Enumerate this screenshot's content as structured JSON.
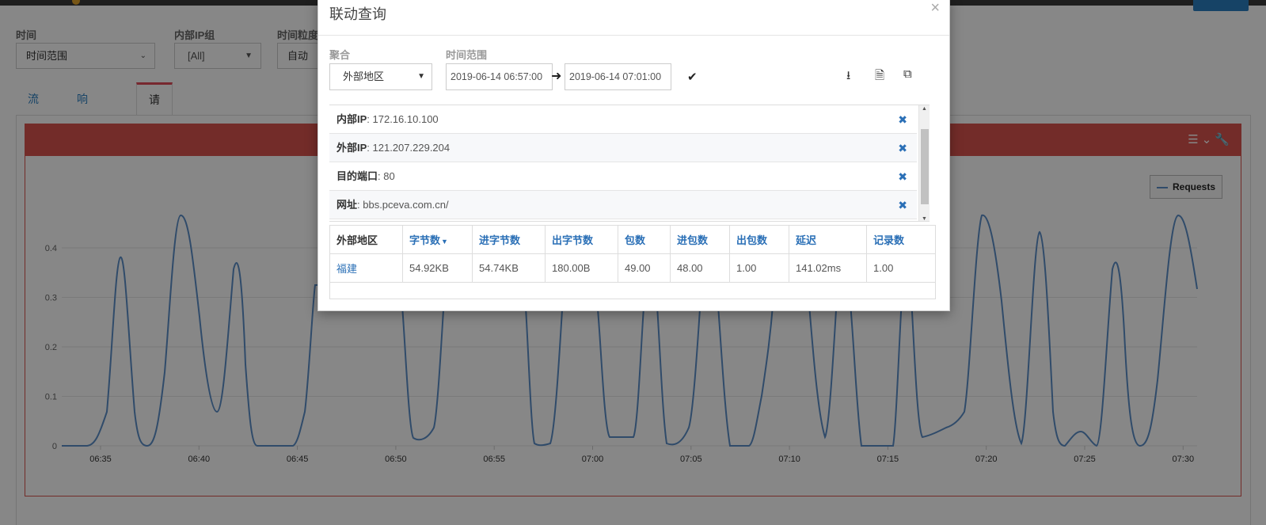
{
  "filters_bar": {
    "time_label": "时间",
    "time_value": "时间范围",
    "ipgroup_label": "内部IP组",
    "ipgroup_value": "[All]",
    "granularity_label": "时间粒度",
    "granularity_value": "自动"
  },
  "tabs": [
    {
      "label": "流量"
    },
    {
      "label": "响应时间"
    },
    {
      "label": "请求数"
    }
  ],
  "active_tab": "请求数",
  "chart_data": {
    "type": "line",
    "series": [
      {
        "name": "Requests"
      }
    ],
    "yticks": [
      "0",
      "0.1",
      "0.2",
      "0.3",
      "0.4"
    ],
    "xticks": [
      "06:35",
      "06:40",
      "06:45",
      "06:50",
      "06:55",
      "07:00",
      "07:05",
      "07:10",
      "07:15",
      "07:20",
      "07:25",
      "07:30"
    ],
    "ylim": [
      0,
      0.45
    ],
    "color": "#5b8fc9"
  },
  "modal": {
    "title": "联动查询",
    "close": "×",
    "agg_label": "聚合",
    "agg_value": "外部地区",
    "range_label": "时间范围",
    "start": "2019-06-14 06:57:00",
    "end": "2019-06-14 07:01:00",
    "filters": [
      {
        "key": "内部IP",
        "value": ": 172.16.10.100"
      },
      {
        "key": "外部IP",
        "value": ": 121.207.229.204"
      },
      {
        "key": "目的端口",
        "value": ": 80"
      },
      {
        "key": "网址",
        "value": ": bbs.pceva.com.cn/"
      }
    ],
    "table": {
      "headers": [
        "外部地区",
        "字节数",
        "进字节数",
        "出字节数",
        "包数",
        "进包数",
        "出包数",
        "延迟",
        "记录数"
      ],
      "rows": [
        [
          "福建",
          "54.92KB",
          "54.74KB",
          "180.00B",
          "49.00",
          "48.00",
          "1.00",
          "141.02ms",
          "1.00"
        ]
      ]
    }
  }
}
